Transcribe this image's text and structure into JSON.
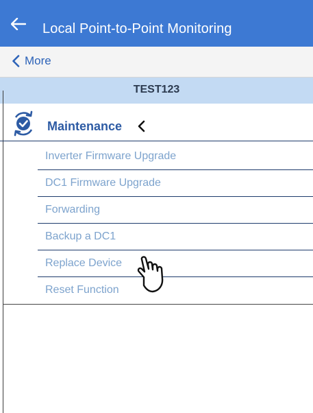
{
  "header": {
    "title": "Local Point-to-Point Monitoring",
    "back_icon": "arrow-left-icon"
  },
  "nav": {
    "back_label": "More",
    "back_icon": "chevron-left-icon"
  },
  "device": {
    "name": "TEST123"
  },
  "section": {
    "label": "Maintenance",
    "icon": "sync-check-icon",
    "caret_icon": "chevron-left-icon",
    "items": [
      {
        "label": "Inverter Firmware Upgrade"
      },
      {
        "label": "DC1 Firmware Upgrade"
      },
      {
        "label": "Forwarding"
      },
      {
        "label": "Backup a DC1"
      },
      {
        "label": "Replace Device"
      },
      {
        "label": "Reset Function"
      }
    ]
  },
  "pointer": {
    "icon": "hand-pointer-icon"
  },
  "colors": {
    "header_bg": "#3d79d3",
    "nav_bg": "#f4f4f4",
    "device_bar_bg": "#c3daf3",
    "section_text": "#2d5ba4",
    "item_text": "#7da3cd",
    "divider": "#1d3a6b"
  }
}
